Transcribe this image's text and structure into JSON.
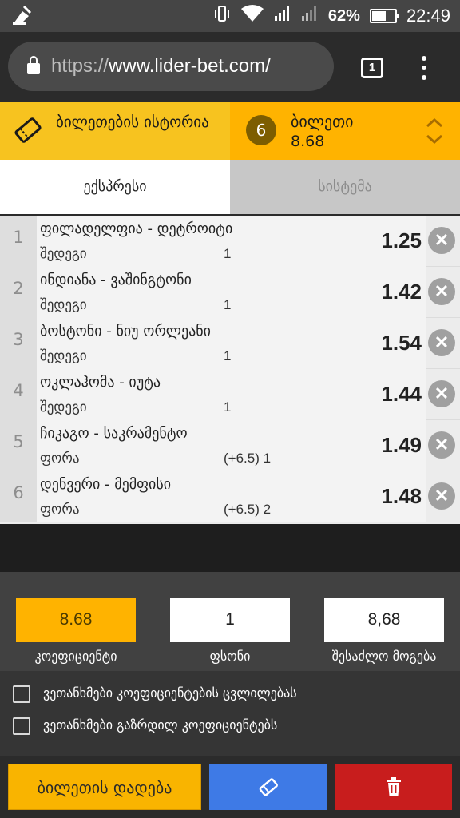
{
  "status_bar": {
    "battery": "62%",
    "battery_level": 0.62,
    "time": "22:49",
    "icons": [
      "cleaner-icon",
      "vibrate-icon",
      "wifi-icon",
      "signal-icon",
      "signal-icon",
      "battery-icon"
    ]
  },
  "browser": {
    "url_proto": "https://",
    "url_host": "www.lider-bet.com/",
    "tab_count": "1"
  },
  "header": {
    "history_label": "ბილეთების ისტორია",
    "slip_count": "6",
    "slip_title": "ბილეთი",
    "slip_total": "8.68"
  },
  "tabs": [
    {
      "label": "ექსპრესი",
      "active": true
    },
    {
      "label": "სისტემა",
      "active": false
    }
  ],
  "bets": [
    {
      "index": "1",
      "event": "ფილადელფია - დეტროიტი",
      "market": "შედეგი",
      "pick": "1",
      "odd": "1.25"
    },
    {
      "index": "2",
      "event": "ინდიანა - ვაშინგტონი",
      "market": "შედეგი",
      "pick": "1",
      "odd": "1.42"
    },
    {
      "index": "3",
      "event": "ბოსტონი - ნიუ ორლეანი",
      "market": "შედეგი",
      "pick": "1",
      "odd": "1.54"
    },
    {
      "index": "4",
      "event": "ოკლაჰომა - იუტა",
      "market": "შედეგი",
      "pick": "1",
      "odd": "1.44"
    },
    {
      "index": "5",
      "event": "ჩიკაგო - საკრამენტო",
      "market": "ფორა",
      "pick": "(+6.5) 1",
      "odd": "1.49"
    },
    {
      "index": "6",
      "event": "დენვერი - მემფისი",
      "market": "ფორა",
      "pick": "(+6.5) 2",
      "odd": "1.48"
    }
  ],
  "summary": {
    "coef_value": "8.68",
    "coef_label": "კოეფიციენტი",
    "stake_value": "1",
    "stake_label": "ფსონი",
    "win_value": "8,68",
    "win_label": "შესაძლო მოგება"
  },
  "options": {
    "accept_odds_change": "ვეთანხმები კოეფიციენტების ცვლილებას",
    "accept_odds_increase": "ვეთანხმები გაზრდილ კოეფიციენტებს"
  },
  "actions": {
    "place_label": "ბილეთის დადება"
  },
  "colors": {
    "accent": "#ffb300",
    "history_bg": "#f7c31f",
    "share": "#3e7ae6",
    "delete": "#c81d1d"
  }
}
